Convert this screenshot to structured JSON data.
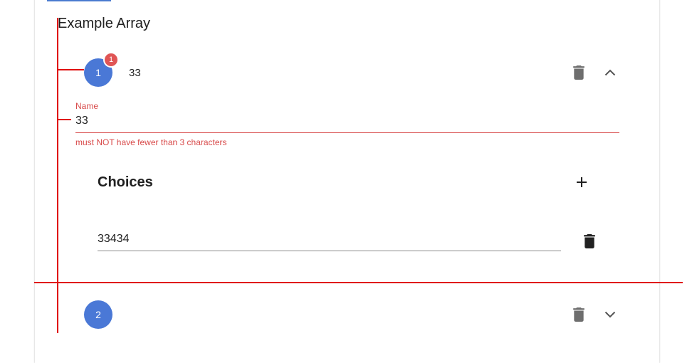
{
  "colors": {
    "accent": "#4a78d6",
    "error": "#d84a4a",
    "error_badge": "#e05555",
    "outline": "#e01010",
    "icon_grey": "#6e6e6e"
  },
  "array": {
    "title": "Example Array",
    "items": [
      {
        "index": "1",
        "badge": "1",
        "title": "33",
        "expanded": true,
        "delete_icon": "delete-icon",
        "toggle_icon": "chevron-up-icon",
        "name_field": {
          "label": "Name",
          "value": "33",
          "error": "must NOT have fewer than 3 characters"
        },
        "choices": {
          "title": "Choices",
          "add_icon": "plus-icon",
          "rows": [
            {
              "value": "33434",
              "delete_icon": "delete-icon"
            }
          ]
        }
      },
      {
        "index": "2",
        "title": "",
        "expanded": false,
        "delete_icon": "delete-icon",
        "toggle_icon": "chevron-down-icon"
      }
    ]
  }
}
